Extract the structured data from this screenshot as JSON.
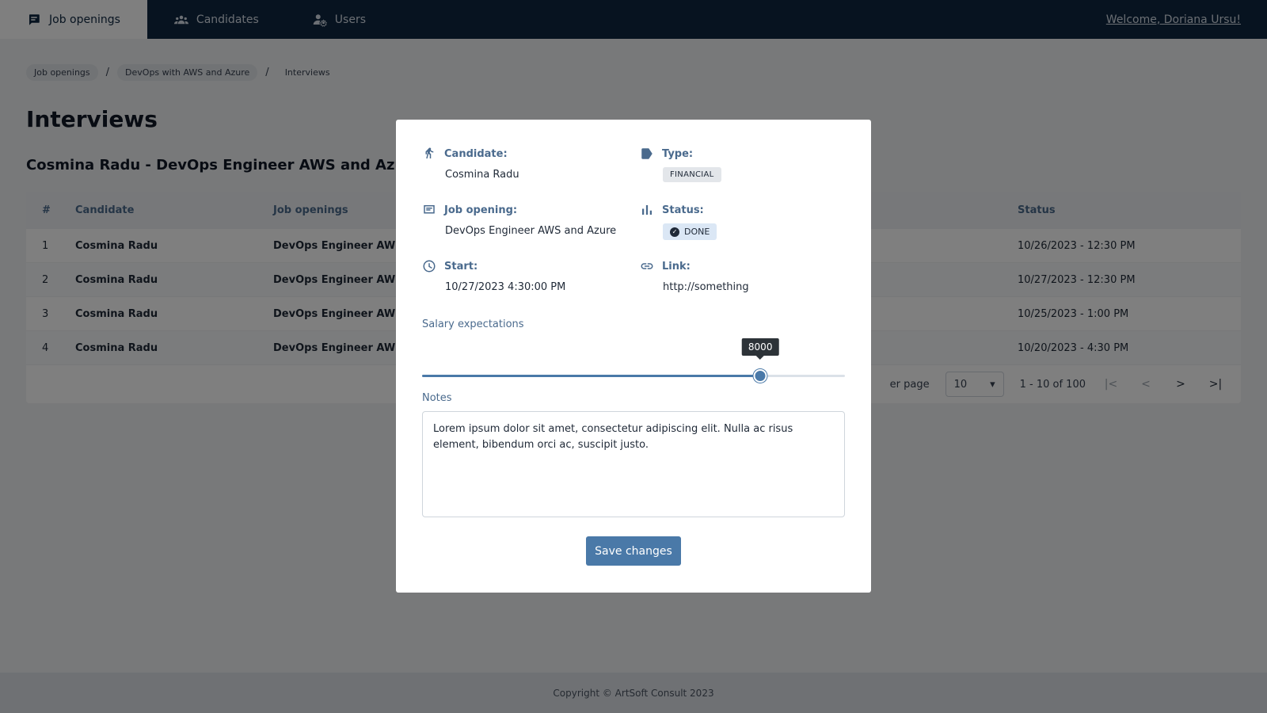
{
  "nav": {
    "tabs": [
      {
        "label": "Job openings",
        "icon": "list-box-icon",
        "active": true
      },
      {
        "label": "Candidates",
        "icon": "people-icon",
        "active": false
      },
      {
        "label": "Users",
        "icon": "user-settings-icon",
        "active": false
      }
    ],
    "welcome": "Welcome, Doriana Ursu!"
  },
  "breadcrumb": [
    "Job openings",
    "DevOps with AWS and Azure",
    "Interviews"
  ],
  "page_title": "Interviews",
  "subtitle": "Cosmina Radu - DevOps Engineer AWS and Azure",
  "table": {
    "headers": [
      "#",
      "Candidate",
      "Job openings",
      "Status"
    ],
    "rows": [
      {
        "num": "1",
        "candidate": "Cosmina Radu",
        "job": "DevOps Engineer AWS a",
        "status": "10/26/2023 - 12:30 PM"
      },
      {
        "num": "2",
        "candidate": "Cosmina Radu",
        "job": "DevOps Engineer AWS a",
        "status": "10/27/2023 - 12:30 PM"
      },
      {
        "num": "3",
        "candidate": "Cosmina Radu",
        "job": "DevOps Engineer AWS a",
        "status": "10/25/2023 - 1:00 PM"
      },
      {
        "num": "4",
        "candidate": "Cosmina Radu",
        "job": "DevOps Engineer AWS a",
        "status": "10/20/2023 - 4:30 PM"
      }
    ],
    "pagination": {
      "per_page_label": "er page",
      "per_page_value": "10",
      "range": "1 - 10 of 100"
    }
  },
  "modal": {
    "candidate_label": "Candidate:",
    "candidate_value": "Cosmina Radu",
    "type_label": "Type:",
    "type_value": "FINANCIAL",
    "job_label": "Job opening:",
    "job_value": "DevOps Engineer AWS and Azure",
    "status_label": "Status:",
    "status_value": "DONE",
    "start_label": "Start:",
    "start_value": "10/27/2023  4:30:00 PM",
    "link_label": "Link:",
    "link_value": "http://something",
    "salary_label": "Salary expectations",
    "salary_value": "8000",
    "salary_fraction": 0.8,
    "notes_label": "Notes",
    "notes_value": "Lorem ipsum dolor sit amet, consectetur adipiscing elit. Nulla ac risus element, bibendum orci ac, suscipit justo.",
    "save_label": "Save changes"
  },
  "footer": "Copyright © ArtSoft Consult 2023",
  "colors": {
    "nav_bg": "#0f2740",
    "accent": "#4a79a8",
    "label": "#4a6a8d"
  }
}
